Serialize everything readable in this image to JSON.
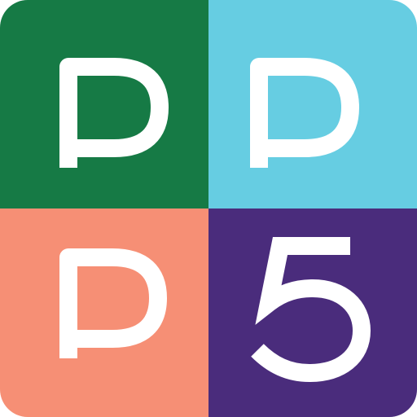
{
  "icon": {
    "tiles": [
      {
        "letter": "P",
        "color": "#167a45"
      },
      {
        "letter": "P",
        "color": "#66cde2"
      },
      {
        "letter": "P",
        "color": "#f68f75"
      },
      {
        "letter": "5",
        "color": "#4a2c7c"
      }
    ],
    "glyph_color": "#ffffff"
  }
}
